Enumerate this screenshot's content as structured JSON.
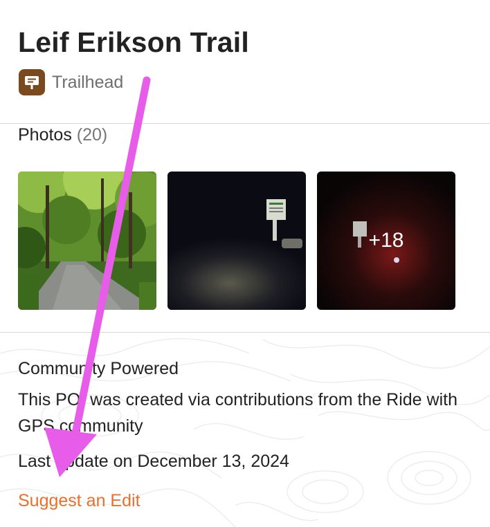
{
  "poi": {
    "title": "Leif Erikson Trail",
    "type_label": "Trailhead",
    "type_icon": "signpost-icon",
    "type_icon_color": "#7a4a1e"
  },
  "photos": {
    "heading": "Photos",
    "count": "(20)",
    "more_label": "+18"
  },
  "community": {
    "title": "Community Powered",
    "description": "This POI was created via contributions from the Ride with GPS community",
    "last_update": "Last update on December 13, 2024",
    "suggest_edit": "Suggest an Edit",
    "link_color": "#e8702a"
  },
  "annotation": {
    "arrow_color": "#e75ce8"
  }
}
